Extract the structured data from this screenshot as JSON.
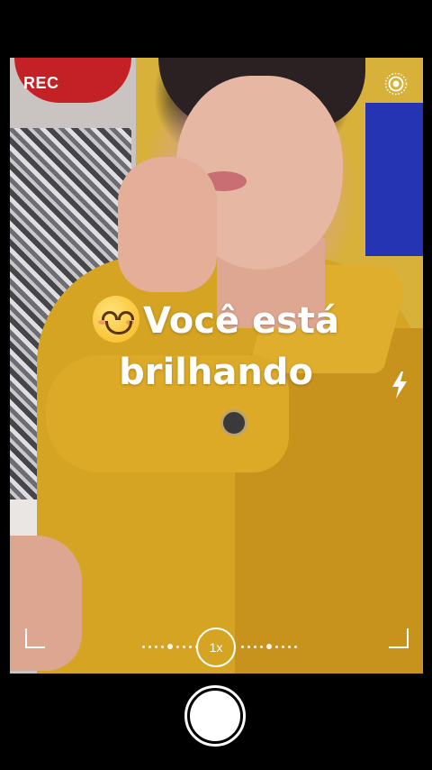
{
  "top_bar": {
    "rec_label": "REC"
  },
  "caption": {
    "line1": "Você está",
    "line2": "brilhando",
    "emoji": "smiling-face-icon"
  },
  "controls": {
    "zoom_label": "1x",
    "live_icon": "live-photo-icon",
    "flash_icon": "flash-icon"
  },
  "colors": {
    "jacket": "#d6a423",
    "accent_text": "#ffffff",
    "background": "#000000"
  }
}
